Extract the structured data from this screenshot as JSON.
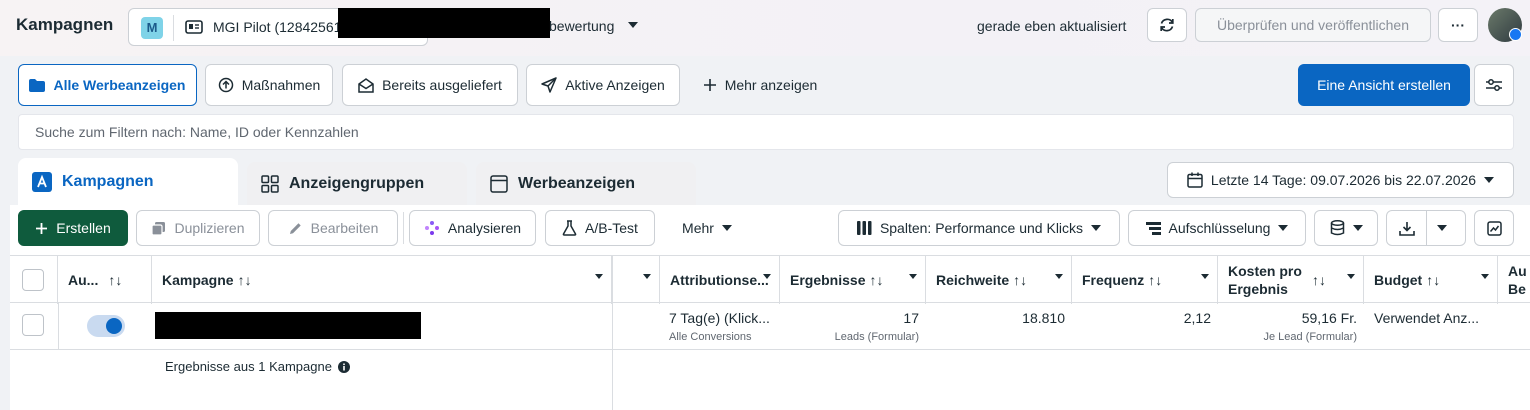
{
  "header": {
    "title": "Kampagnen",
    "account_badge": "M",
    "account_name": "MGI Pilot (128425615",
    "account_suffix": "bewertung",
    "updated_text": "gerade eben aktualisiert",
    "publish_label": "Überprüfen und veröffentlichen",
    "more_label": "···"
  },
  "filters": {
    "buttons": [
      {
        "label": "Alle Werbeanzeigen"
      },
      {
        "label": "Maßnahmen"
      },
      {
        "label": "Bereits ausgeliefert"
      },
      {
        "label": "Aktive Anzeigen"
      },
      {
        "label": "Mehr anzeigen"
      }
    ],
    "create_view_label": "Eine Ansicht erstellen",
    "search_placeholder": "Suche zum Filtern nach: Name, ID oder Kennzahlen"
  },
  "tabs": [
    {
      "label": "Kampagnen"
    },
    {
      "label": "Anzeigengruppen"
    },
    {
      "label": "Werbeanzeigen"
    }
  ],
  "date_range": "Letzte 14 Tage: 09.07.2026 bis 22.07.2026",
  "toolbar": {
    "create": "Erstellen",
    "duplicate": "Duplizieren",
    "edit": "Bearbeiten",
    "analyze": "Analysieren",
    "ab_test": "A/B-Test",
    "more": "Mehr",
    "columns": "Spalten: Performance und Klicks",
    "breakdown": "Aufschlüsselung"
  },
  "table": {
    "columns": {
      "status": "Au...",
      "campaign": "Kampagne",
      "attribution": "Attributionse...",
      "results": "Ergebnisse",
      "reach": "Reichweite",
      "frequency": "Frequenz",
      "cost_line1": "Kosten pro",
      "cost_line2": "Ergebnis",
      "budget": "Budget",
      "cut_line1": "Au",
      "cut_line2": "Be"
    },
    "sort_glyph": "↑↓",
    "row": {
      "toggle_on": true,
      "attribution": "7 Tag(e) (Klick...",
      "attribution_sub": "Alle Conversions",
      "results": "17",
      "results_sub": "Leads (Formular)",
      "reach": "18.810",
      "frequency": "2,12",
      "cost": "59,16 Fr.",
      "cost_sub": "Je Lead (Formular)",
      "budget": "Verwendet Anz..."
    },
    "summary": "Ergebnisse aus 1 Kampagne"
  },
  "colors": {
    "accent": "#0a66c2",
    "green": "#0f5b3d"
  }
}
